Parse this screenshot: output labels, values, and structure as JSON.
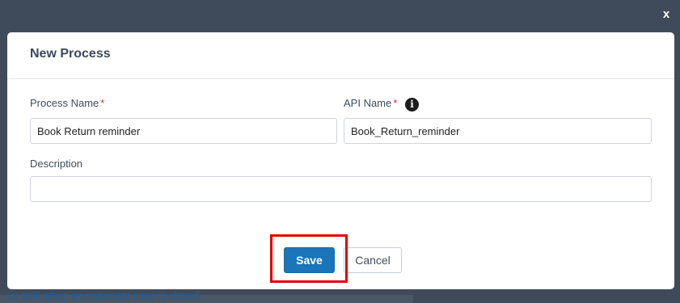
{
  "modal": {
    "title": "New Process",
    "close_glyph": "x",
    "required_marker": "*"
  },
  "fields": {
    "process_name": {
      "label": "Process Name",
      "value": "Book Return reminder"
    },
    "api_name": {
      "label": "API Name",
      "value": "Book_Return_reminder",
      "info_icon": "info-icon",
      "info_glyph": "i"
    },
    "description": {
      "label": "Description",
      "value": ""
    }
  },
  "buttons": {
    "save_label": "Save",
    "cancel_label": "Cancel"
  },
  "background": {
    "bottom_text": "-up task when an important case is closed"
  },
  "colors": {
    "backdrop": "#3f4b5b",
    "primary": "#1a75b9",
    "required": "#c23934",
    "highlight": "#e00000"
  }
}
